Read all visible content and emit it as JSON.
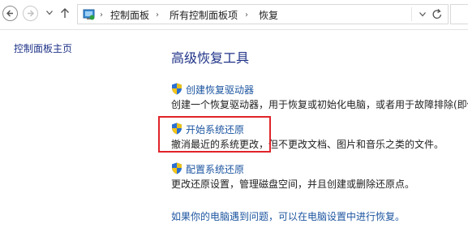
{
  "breadcrumb": {
    "items": [
      "控制面板",
      "所有控制面板项",
      "恢复"
    ],
    "separator": "›"
  },
  "left_pane": {
    "home_link": "控制面板主页"
  },
  "main": {
    "title": "高级恢复工具",
    "tasks": [
      {
        "label": "创建恢复驱动器",
        "description": "创建一个恢复驱动器，用于恢复或初始化电脑，或者用于故障排除(即使"
      },
      {
        "label": "开始系统还原",
        "description": "撤消最近的系统更改，但不更改文档、图片和音乐之类的文件。"
      },
      {
        "label": "配置系统还原",
        "description": "更改还原设置，管理磁盘空间，并且创建或删除还原点。"
      }
    ],
    "footer_link": "如果你的电脑遇到问题，可以在电脑设置中进行恢复。"
  },
  "icons": {
    "back": "back-arrow-icon",
    "forward": "forward-arrow-icon",
    "recent": "chevron-down-icon",
    "up": "up-arrow-icon",
    "control_panel": "control-panel-icon",
    "refresh": "refresh-icon",
    "uac_shield": "uac-shield-icon"
  },
  "colors": {
    "link": "#1e56a0",
    "title": "#1e3287",
    "highlight": "#e0242a"
  }
}
